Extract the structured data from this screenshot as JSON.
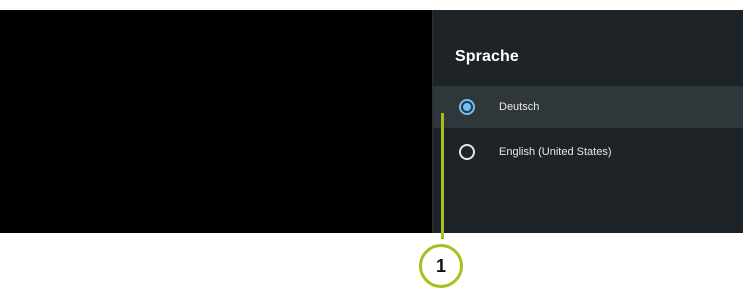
{
  "settings_panel": {
    "title": "Sprache",
    "options": [
      {
        "label": "Deutsch",
        "selected": true,
        "focused": true
      },
      {
        "label": "English (United States)",
        "selected": false,
        "focused": false
      }
    ]
  },
  "callout": {
    "number": "1",
    "color": "#a6c21a"
  },
  "colors": {
    "panel_bg": "#1d2326",
    "focus_bg": "#2f373a",
    "radio_accent": "#6cc0ff"
  }
}
